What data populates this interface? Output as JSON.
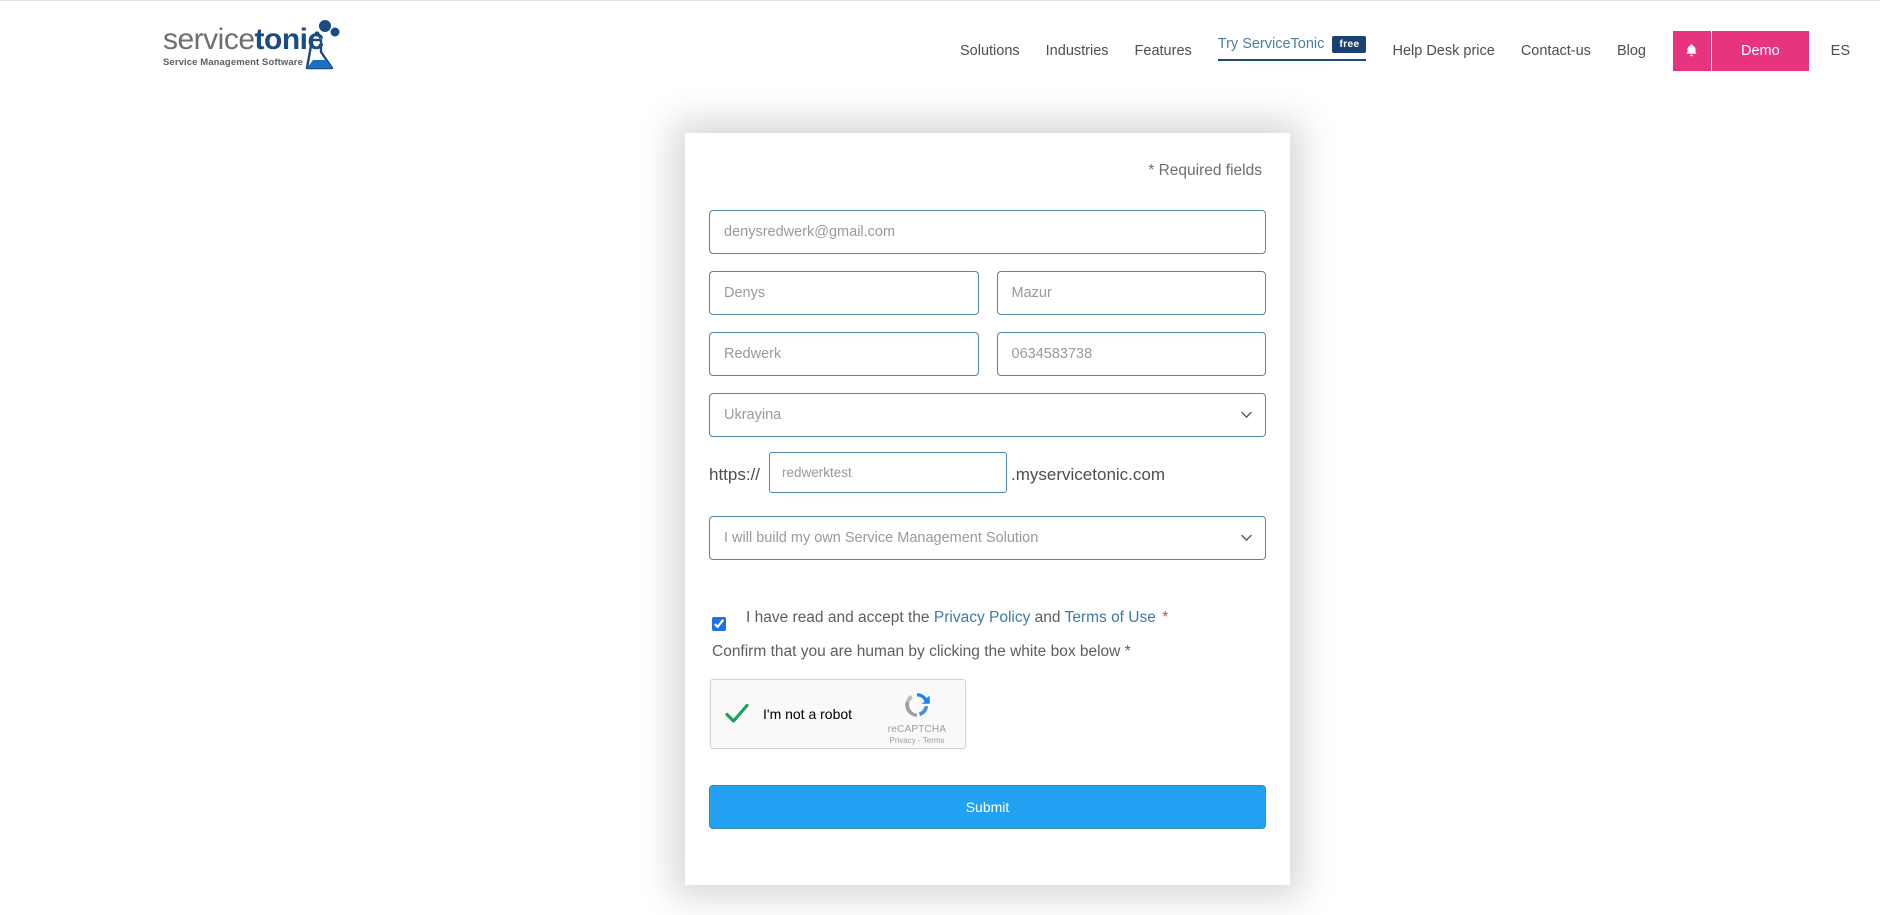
{
  "brand": {
    "logo_service": "service",
    "logo_tonic": "tonic",
    "logo_tagline": "Service Management Software",
    "logo_icon": "flask-icon",
    "accent_pink": "#e8337f",
    "accent_blue": "#22a1f2",
    "navy": "#1b4170",
    "field_border": "#4f88a3"
  },
  "nav": {
    "items": [
      {
        "label": "Solutions"
      },
      {
        "label": "Industries"
      },
      {
        "label": "Features"
      }
    ],
    "active_item": {
      "label": "Try ServiceTonic",
      "badge": "free"
    },
    "items_after": [
      {
        "label": "Help Desk price"
      },
      {
        "label": "Contact-us"
      },
      {
        "label": "Blog"
      }
    ],
    "bell_icon": "bell-icon",
    "demo_label": "Demo",
    "language_label": "ES"
  },
  "form": {
    "required_note": "* Required fields",
    "email": {
      "placeholder": "denysredwerk@gmail.com",
      "value": ""
    },
    "first_name": {
      "placeholder": "Denys",
      "value": ""
    },
    "last_name": {
      "placeholder": "Mazur",
      "value": ""
    },
    "company": {
      "placeholder": "Redwerk",
      "value": ""
    },
    "phone": {
      "placeholder": "0634583738",
      "value": ""
    },
    "country": {
      "selected": "Ukrayina",
      "options": [
        "Ukrayina"
      ]
    },
    "subdomain": {
      "prefix": "https://",
      "placeholder": "redwerktest",
      "value": "",
      "suffix": ".myservicetonic.com"
    },
    "solution": {
      "selected": "I will build my own Service Management Solution",
      "options": [
        "I will build my own Service Management Solution"
      ]
    },
    "consent": {
      "checked": true,
      "text_before": "I have read and accept the",
      "privacy_link": "Privacy Policy",
      "text_middle": "and",
      "terms_link": "Terms of Use",
      "required_mark": "*"
    },
    "human_note": "Confirm that you are human by clicking the white box below *",
    "recaptcha": {
      "label": "I'm not a robot",
      "verified": true,
      "brand": "reCAPTCHA",
      "privacy": "Privacy",
      "separator": "-",
      "terms": "Terms"
    },
    "submit_label": "Submit"
  }
}
